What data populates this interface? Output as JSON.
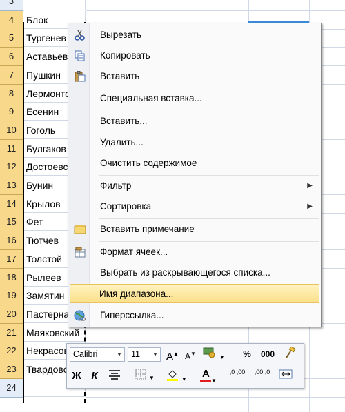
{
  "rows": [
    {
      "num": "3",
      "text": ""
    },
    {
      "num": "4",
      "text": "Блок"
    },
    {
      "num": "5",
      "text": "Тургенев"
    },
    {
      "num": "6",
      "text": "Аставьев"
    },
    {
      "num": "7",
      "text": "Пушкин"
    },
    {
      "num": "8",
      "text": "Лермонтов"
    },
    {
      "num": "9",
      "text": "Есенин"
    },
    {
      "num": "10",
      "text": "Гоголь"
    },
    {
      "num": "11",
      "text": "Булгаков"
    },
    {
      "num": "12",
      "text": "Достоевский"
    },
    {
      "num": "13",
      "text": "Бунин"
    },
    {
      "num": "14",
      "text": "Крылов"
    },
    {
      "num": "15",
      "text": "Фет"
    },
    {
      "num": "16",
      "text": "Тютчев"
    },
    {
      "num": "17",
      "text": "Толстой"
    },
    {
      "num": "18",
      "text": "Рылеев"
    },
    {
      "num": "19",
      "text": "Замятин"
    },
    {
      "num": "20",
      "text": "Пастернак"
    },
    {
      "num": "21",
      "text": "Маяковский"
    },
    {
      "num": "22",
      "text": "Некрасов"
    },
    {
      "num": "23",
      "text": "Твардовский"
    },
    {
      "num": "24",
      "text": ""
    }
  ],
  "menu": {
    "cut": "Вырезать",
    "copy": "Копировать",
    "paste": "Вставить",
    "paste_special": "Специальная вставка...",
    "insert": "Вставить...",
    "delete": "Удалить...",
    "clear": "Очистить содержимое",
    "filter": "Фильтр",
    "sort": "Сортировка",
    "insert_comment": "Вставить примечание",
    "format_cells": "Формат ячеек...",
    "pick_list": "Выбрать из раскрывающегося списка...",
    "name_range": "Имя диапазона...",
    "hyperlink": "Гиперссылка..."
  },
  "toolbar": {
    "font": "Calibri",
    "size": "11",
    "grow": "A",
    "shrink": "A",
    "percent": "%",
    "thousands": "000",
    "bold": "Ж",
    "italic": "К",
    "font_color_letter": "A",
    "inc_decimal": ",0 ,00",
    "dec_decimal": ",00 ,0"
  },
  "colors": {
    "highlight": "#fbe08a",
    "selected_header": "#f8d88a",
    "font_color_bar": "#e02020",
    "fill_color_bar": "#ffff00"
  }
}
